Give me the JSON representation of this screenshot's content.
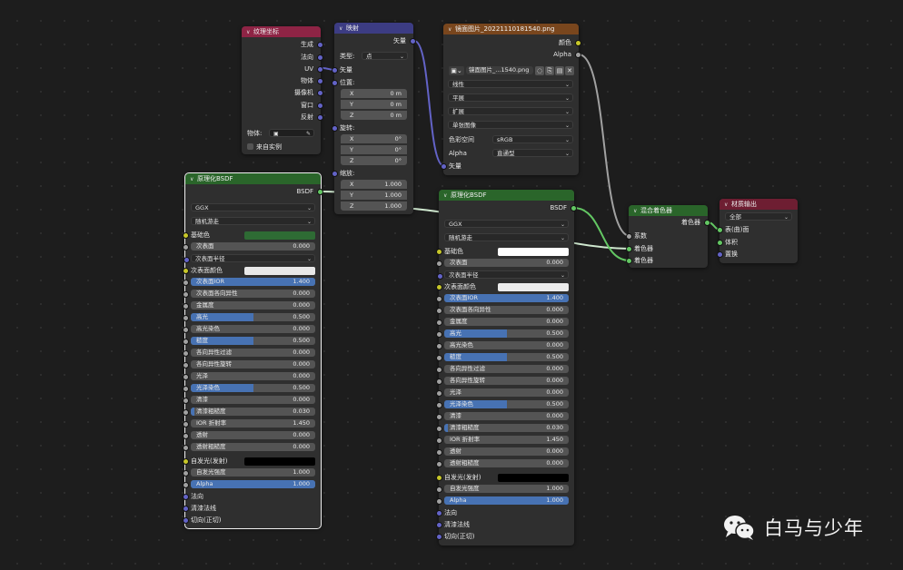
{
  "watermark": {
    "text": "白马与少年",
    "icon": "wechat-icon"
  },
  "colors": {
    "background": "#1d1d1d",
    "texcoord_header": "#8e2445",
    "mapping_header": "#3c3c83",
    "image_header": "#79461d",
    "shader_header": "#2a652a",
    "output_header": "#6e1e32",
    "vector_socket": "#6363c7",
    "color_socket": "#c7c729",
    "shader_socket": "#63c763",
    "value_socket": "#a1a1a1",
    "field_fill": "#4772b3"
  },
  "texcoord": {
    "title": "纹理坐标",
    "outputs": [
      "生成",
      "法向",
      "UV",
      "物体",
      "摄像机",
      "窗口",
      "反射"
    ],
    "object_label": "物体:",
    "from_instancer": "来自实例"
  },
  "mapping": {
    "title": "映射",
    "output": "矢量",
    "type_label": "类型:",
    "type_value": "点",
    "vector_input": "矢量",
    "location_label": "位置:",
    "location": [
      {
        "axis": "X",
        "value": "0 m"
      },
      {
        "axis": "Y",
        "value": "0 m"
      },
      {
        "axis": "Z",
        "value": "0 m"
      }
    ],
    "rotation_label": "旋转:",
    "rotation": [
      {
        "axis": "X",
        "value": "0°"
      },
      {
        "axis": "Y",
        "value": "0°"
      },
      {
        "axis": "Z",
        "value": "0°"
      }
    ],
    "scale_label": "缩放:",
    "scale": [
      {
        "axis": "X",
        "value": "1.000"
      },
      {
        "axis": "Y",
        "value": "1.000"
      },
      {
        "axis": "Z",
        "value": "1.000"
      }
    ]
  },
  "image": {
    "title": "镜面图片_20221110181540.png",
    "outputs": [
      "颜色",
      "Alpha"
    ],
    "image_name": "镜面图片_...1540.png",
    "interpolation": "线性",
    "projection": "平展",
    "extension": "扩展",
    "source": "单张图像",
    "colorspace_label": "色彩空间",
    "colorspace_value": "sRGB",
    "alpha_label": "Alpha",
    "alpha_value": "直通型",
    "vector_input": "矢量"
  },
  "bsdf1": {
    "title": "原理化BSDF",
    "output": "BSDF",
    "distribution": "GGX",
    "subsurface_method": "随机游走",
    "base_color_label": "基础色",
    "base_color": "#2e6b34",
    "subsurface": {
      "label": "次表面",
      "value": "0.000"
    },
    "subsurface_radius": "次表面半径",
    "subsurface_color_label": "次表面颜色",
    "subsurface_color": "#e8e8e8",
    "fields": [
      {
        "label": "次表面IOR",
        "value": "1.400",
        "fill": 1.0
      },
      {
        "label": "次表面各向异性",
        "value": "0.000",
        "fill": 0
      },
      {
        "label": "金属度",
        "value": "0.000",
        "fill": 0
      },
      {
        "label": "高光",
        "value": "0.500",
        "fill": 0.5
      },
      {
        "label": "高光染色",
        "value": "0.000",
        "fill": 0
      },
      {
        "label": "糙度",
        "value": "0.500",
        "fill": 0.5
      },
      {
        "label": "各向异性过滤",
        "value": "0.000",
        "fill": 0
      },
      {
        "label": "各向异性旋转",
        "value": "0.000",
        "fill": 0
      },
      {
        "label": "光泽",
        "value": "0.000",
        "fill": 0
      },
      {
        "label": "光泽染色",
        "value": "0.500",
        "fill": 0.5
      },
      {
        "label": "清漆",
        "value": "0.000",
        "fill": 0
      },
      {
        "label": "清漆粗糙度",
        "value": "0.030",
        "fill": 0.03
      },
      {
        "label": "IOR 折射率",
        "value": "1.450",
        "fill": 0
      },
      {
        "label": "透射",
        "value": "0.000",
        "fill": 0
      },
      {
        "label": "透射粗糙度",
        "value": "0.000",
        "fill": 0
      }
    ],
    "emission_label": "自发光(发射)",
    "emission_color": "#000000",
    "emission_strength": {
      "label": "自发光强度",
      "value": "1.000"
    },
    "alpha": {
      "label": "Alpha",
      "value": "1.000",
      "fill": 1.0
    },
    "vector_inputs": [
      "法向",
      "清漆法线",
      "切向(正切)"
    ]
  },
  "bsdf2": {
    "title": "原理化BSDF",
    "output": "BSDF",
    "distribution": "GGX",
    "subsurface_method": "随机游走",
    "base_color_label": "基础色",
    "base_color": "#ffffff",
    "subsurface": {
      "label": "次表面",
      "value": "0.000"
    },
    "subsurface_radius": "次表面半径",
    "subsurface_color_label": "次表面颜色",
    "subsurface_color": "#ececec",
    "fields": [
      {
        "label": "次表面IOR",
        "value": "1.400",
        "fill": 1.0
      },
      {
        "label": "次表面各向异性",
        "value": "0.000",
        "fill": 0
      },
      {
        "label": "金属度",
        "value": "0.000",
        "fill": 0
      },
      {
        "label": "高光",
        "value": "0.500",
        "fill": 0.5
      },
      {
        "label": "高光染色",
        "value": "0.000",
        "fill": 0
      },
      {
        "label": "糙度",
        "value": "0.500",
        "fill": 0.5
      },
      {
        "label": "各向异性过滤",
        "value": "0.000",
        "fill": 0
      },
      {
        "label": "各向异性旋转",
        "value": "0.000",
        "fill": 0
      },
      {
        "label": "光泽",
        "value": "0.000",
        "fill": 0
      },
      {
        "label": "光泽染色",
        "value": "0.500",
        "fill": 0.5
      },
      {
        "label": "清漆",
        "value": "0.000",
        "fill": 0
      },
      {
        "label": "清漆粗糙度",
        "value": "0.030",
        "fill": 0.03
      },
      {
        "label": "IOR 折射率",
        "value": "1.450",
        "fill": 0
      },
      {
        "label": "透射",
        "value": "0.000",
        "fill": 0
      },
      {
        "label": "透射粗糙度",
        "value": "0.000",
        "fill": 0
      }
    ],
    "emission_label": "自发光(发射)",
    "emission_color": "#000000",
    "emission_strength": {
      "label": "自发光强度",
      "value": "1.000"
    },
    "alpha": {
      "label": "Alpha",
      "value": "1.000",
      "fill": 1.0
    },
    "vector_inputs": [
      "法向",
      "清漆法线",
      "切向(正切)"
    ]
  },
  "mix": {
    "title": "混合着色器",
    "output": "着色器",
    "inputs": [
      "系数",
      "着色器",
      "着色器"
    ]
  },
  "output": {
    "title": "材质输出",
    "target": "全部",
    "inputs": [
      "表(曲)面",
      "体积",
      "置换"
    ]
  }
}
